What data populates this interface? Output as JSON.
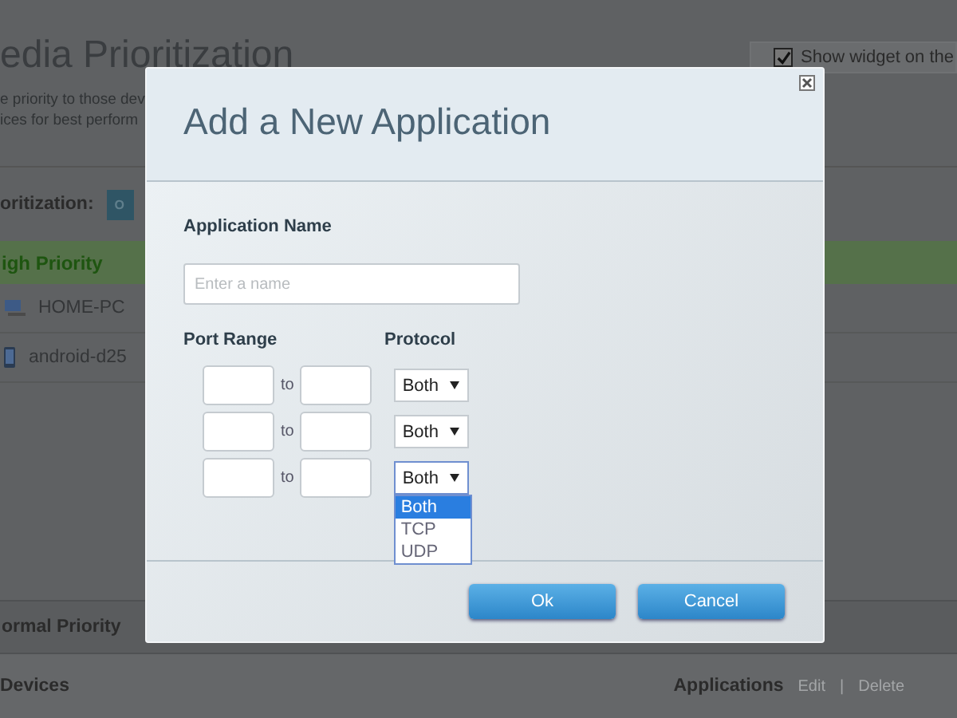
{
  "page": {
    "title": "edia Prioritization",
    "description": [
      "e priority to those dev",
      "ices for best perform"
    ],
    "widget_option": {
      "label": "Show widget on the",
      "checked": true
    },
    "prioritization": {
      "label": "oritization:",
      "toggle": "O"
    },
    "high_priority": {
      "label": "igh Priority",
      "devices": [
        {
          "kind": "computer",
          "name": "HOME-PC"
        },
        {
          "kind": "phone",
          "name": "android-d25"
        }
      ]
    },
    "normal_priority": {
      "label": "ormal Priority"
    },
    "devices_header": {
      "label": "Devices",
      "applications": "Applications",
      "actions": [
        "Edit",
        "Delete"
      ],
      "separator": "|"
    }
  },
  "dialog": {
    "title": "Add a New Application",
    "name_label": "Application Name",
    "name_field": {
      "placeholder": "Enter a name"
    },
    "port_range_label": "Port Range",
    "protocol_label": "Protocol",
    "rows": [
      {
        "to_label": "to",
        "protocol": "Both",
        "open": false
      },
      {
        "to_label": "to",
        "protocol": "Both",
        "open": false
      },
      {
        "to_label": "to",
        "protocol": "Both",
        "open": true
      }
    ],
    "dropdown_options": [
      {
        "label": "Both",
        "selected": true
      },
      {
        "label": "TCP",
        "selected": false
      },
      {
        "label": "UDP",
        "selected": false
      }
    ],
    "buttons": [
      "Ok",
      "Cancel"
    ]
  }
}
